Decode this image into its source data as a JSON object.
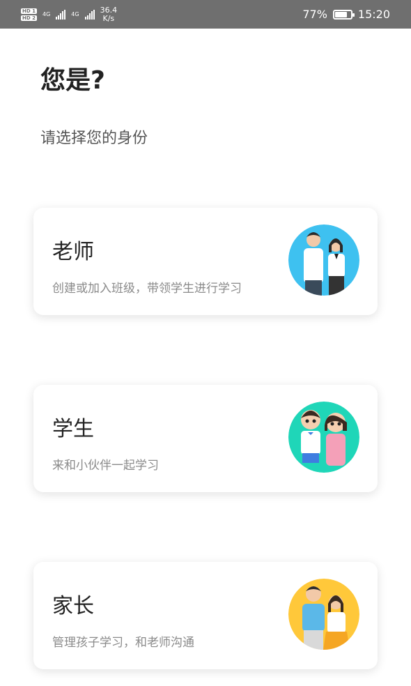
{
  "status_bar": {
    "sim1": "HD 1",
    "sim2": "HD 2",
    "net1": "4G",
    "net2": "4G",
    "speed_value": "36.4",
    "speed_unit": "K/s",
    "battery_percent": "77%",
    "battery_level": 0.77,
    "time": "15:20"
  },
  "header": {
    "title": "您是?",
    "subtitle": "请选择您的身份"
  },
  "roles": [
    {
      "name": "老师",
      "desc": "创建或加入班级，带领学生进行学习",
      "avatar_bg": "#3ec1f0",
      "avatar_icon": "teacher-couple"
    },
    {
      "name": "学生",
      "desc": "来和小伙伴一起学习",
      "avatar_bg": "#1fd6b8",
      "avatar_icon": "student-pair"
    },
    {
      "name": "家长",
      "desc": "管理孩子学习，和老师沟通",
      "avatar_bg": "#ffc83a",
      "avatar_icon": "parent-couple"
    }
  ]
}
